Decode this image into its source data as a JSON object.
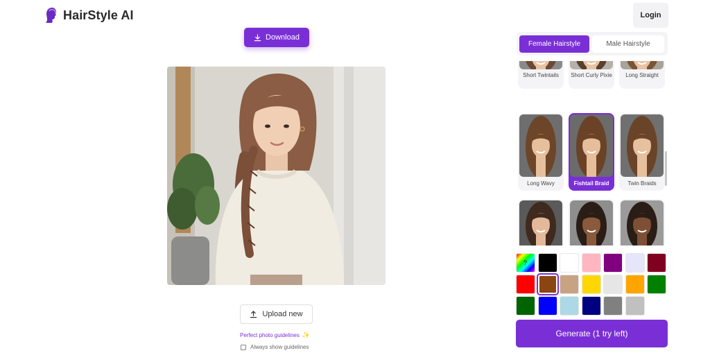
{
  "app": {
    "name": "HairStyle AI"
  },
  "header": {
    "login_label": "Login"
  },
  "editor": {
    "download_label": "Download",
    "upload_label": "Upload new",
    "guidelines_link": "Perfect photo guidelines",
    "always_show_label": "Always show guidelines",
    "always_show_checked": false
  },
  "tabs": [
    {
      "label": "Female Hairstyle",
      "active": true
    },
    {
      "label": "Male Hairstyle",
      "active": false
    }
  ],
  "styles": [
    {
      "label": "Short Twintails",
      "hair": "#6b4a34",
      "skin": "#e8c4a6",
      "bg": "#8a8a8a"
    },
    {
      "label": "Short Curly Pixie",
      "hair": "#5a3f2c",
      "skin": "#e6c3a4",
      "bg": "#b5b0aa"
    },
    {
      "label": "Long Straight",
      "hair": "#7a5536",
      "skin": "#e8c2a2",
      "bg": "#a8a39b"
    },
    {
      "label": "Long Wavy",
      "hair": "#6d4528",
      "skin": "#e6bf9c",
      "bg": "#6e6e6e"
    },
    {
      "label": "Fishtail Braid",
      "hair": "#6a4226",
      "skin": "#e6be9a",
      "bg": "#6b6b6b",
      "selected": true
    },
    {
      "label": "Twin Braids",
      "hair": "#6a4428",
      "skin": "#e7c09e",
      "bg": "#707070"
    },
    {
      "label": "",
      "hair": "#3e2a1e",
      "skin": "#e3b999",
      "bg": "#5a5a5a"
    },
    {
      "label": "",
      "hair": "#2a1d16",
      "skin": "#8a5a3c",
      "bg": "#8e8e8e"
    },
    {
      "label": "",
      "hair": "#2a1d16",
      "skin": "#7d5035",
      "bg": "#9b9b9b"
    }
  ],
  "colors": [
    {
      "name": "random",
      "value": "multi"
    },
    {
      "name": "black",
      "value": "#000000"
    },
    {
      "name": "white",
      "value": "#ffffff"
    },
    {
      "name": "pink",
      "value": "#ffb6c1"
    },
    {
      "name": "purple",
      "value": "#800080"
    },
    {
      "name": "lavender",
      "value": "#e6e6fa"
    },
    {
      "name": "burgundy",
      "value": "#800020"
    },
    {
      "name": "red",
      "value": "#ff0000"
    },
    {
      "name": "brown",
      "value": "#8b4513",
      "selected": true
    },
    {
      "name": "light-brown",
      "value": "#c8a383"
    },
    {
      "name": "yellow",
      "value": "#ffd700"
    },
    {
      "name": "silver",
      "value": "#e6e6e6"
    },
    {
      "name": "orange",
      "value": "#ffa500"
    },
    {
      "name": "green",
      "value": "#008000"
    },
    {
      "name": "dark-green",
      "value": "#006400"
    },
    {
      "name": "blue",
      "value": "#0000ff"
    },
    {
      "name": "light-blue",
      "value": "#add8e6"
    },
    {
      "name": "navy",
      "value": "#000080"
    },
    {
      "name": "gray",
      "value": "#808080"
    },
    {
      "name": "light-gray",
      "value": "#c0c0c0"
    }
  ],
  "generate_label": "Generate (1 try left)",
  "accent": "#7a2fd6"
}
